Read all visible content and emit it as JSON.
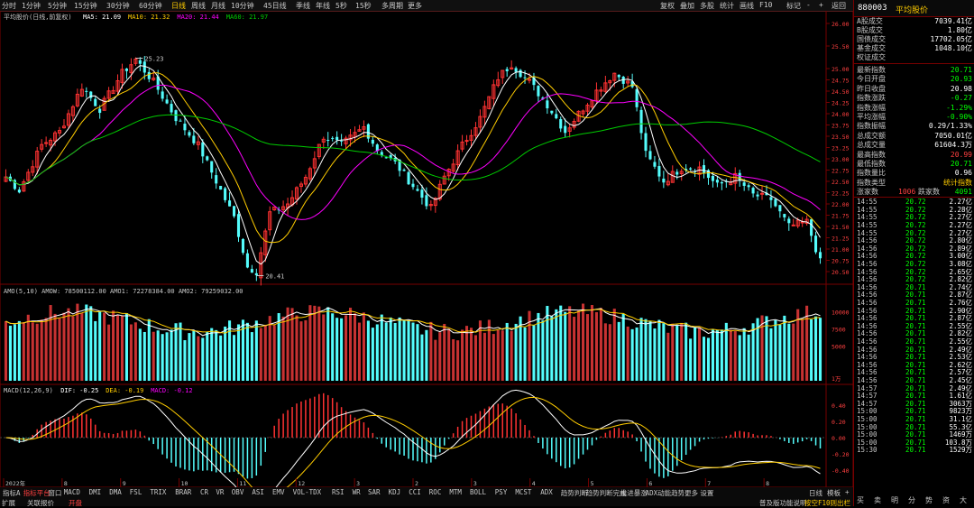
{
  "toolbar": {
    "periods": [
      "分时",
      "1分钟",
      "5分钟",
      "15分钟",
      "30分钟",
      "60分钟",
      "日线",
      "周线",
      "月线",
      "10分钟",
      "45日线",
      "季线",
      "年线",
      "5秒",
      "15秒",
      "多周期",
      "更多"
    ],
    "active_period": "日线",
    "right_buttons": [
      "复权",
      "叠加",
      "多股",
      "统计",
      "画线",
      "F10",
      "标记",
      "-",
      "+",
      "返回"
    ]
  },
  "main_chart": {
    "title": "平均股价(日线,前复权)",
    "ma": [
      {
        "label": "MA5: 21.09",
        "color": "#ffffff"
      },
      {
        "label": "MA10: 21.32",
        "color": "#ffcc00"
      },
      {
        "label": "MA20: 21.44",
        "color": "#ff00ff"
      },
      {
        "label": "MA60: 21.97",
        "color": "#00cc00"
      }
    ],
    "high_label": "25.23",
    "low_label": "20.41",
    "price_ticks": [
      "26.00",
      "25.50",
      "25.00",
      "24.75",
      "24.50",
      "24.25",
      "24.00",
      "23.75",
      "23.50",
      "23.25",
      "23.00",
      "22.75",
      "22.50",
      "22.25",
      "22.00",
      "21.75",
      "21.50",
      "21.25",
      "21.00",
      "20.75",
      "20.50"
    ]
  },
  "volume_panel": {
    "title": "AMO(5,10)  AMOW: 78500112.00  AMO1: 72278384.00  AMO2: 79259032.00",
    "ticks": [
      "10000",
      "7500",
      "5000"
    ],
    "unit_label": "1万"
  },
  "macd_panel": {
    "title_parts": [
      {
        "label": "MACD(12,26,9)",
        "color": "#c8c8c8"
      },
      {
        "label": "DIF: -0.25",
        "color": "#ffffff"
      },
      {
        "label": "DEA: -0.19",
        "color": "#ffcc00"
      },
      {
        "label": "MACD: -0.12",
        "color": "#ff00ff"
      }
    ],
    "ticks": [
      "0.40",
      "0.20",
      "0.00",
      "-0.20",
      "-0.40"
    ],
    "date_ticks": [
      "2022年",
      "8",
      "9",
      "10",
      "11",
      "12",
      "3",
      "2",
      "3",
      "4",
      "5",
      "6",
      "7",
      "8"
    ]
  },
  "right_panel": {
    "code": "880003",
    "name": "平均股价",
    "stats": [
      {
        "label": "A股成交",
        "value": "7039.41亿",
        "color": "#ffffff"
      },
      {
        "label": "B股成交",
        "value": "1.80亿",
        "color": "#ffffff"
      },
      {
        "label": "国债成交",
        "value": "17702.05亿",
        "color": "#ffffff"
      },
      {
        "label": "基金成交",
        "value": "1048.10亿",
        "color": "#ffffff"
      },
      {
        "label": "权证成交",
        "value": "",
        "color": "#ffffff"
      }
    ],
    "index_stats": [
      {
        "label": "最新指数",
        "value": "20.71",
        "color": "#00ff00"
      },
      {
        "label": "今日开盘",
        "value": "20.93",
        "color": "#00ff00"
      },
      {
        "label": "昨日收盘",
        "value": "20.98",
        "color": "#ffffff"
      },
      {
        "label": "指数涨跌",
        "value": "-0.27",
        "color": "#00ff00"
      },
      {
        "label": "指数涨幅",
        "value": "-1.29%",
        "color": "#00ff00"
      },
      {
        "label": "平均涨幅",
        "value": "-0.90%",
        "color": "#00ff00"
      },
      {
        "label": "指数振幅",
        "value": "0.29/1.33%",
        "color": "#ffffff"
      },
      {
        "label": "总成交额",
        "value": "7050.01亿",
        "color": "#ffffff"
      },
      {
        "label": "总成交量",
        "value": "61604.3万",
        "color": "#ffffff"
      },
      {
        "label": "最高指数",
        "value": "20.99",
        "color": "#ff4040"
      },
      {
        "label": "最低指数",
        "value": "20.71",
        "color": "#00ff00"
      },
      {
        "label": "指数量比",
        "value": "0.96",
        "color": "#ffffff"
      },
      {
        "label": "指数类型",
        "value": "统计指数",
        "color": "#ffcc00"
      }
    ],
    "updown": {
      "up_label": "涨家数",
      "up_value": "1006",
      "down_label": "跌家数",
      "down_value": "4091"
    },
    "ticks": [
      {
        "t": "14:55",
        "p": "20.72",
        "v": "2.27亿"
      },
      {
        "t": "14:55",
        "p": "20.72",
        "v": "2.28亿"
      },
      {
        "t": "14:55",
        "p": "20.72",
        "v": "2.27亿"
      },
      {
        "t": "14:55",
        "p": "20.72",
        "v": "2.27亿"
      },
      {
        "t": "14:55",
        "p": "20.72",
        "v": "2.27亿"
      },
      {
        "t": "14:56",
        "p": "20.72",
        "v": "2.80亿"
      },
      {
        "t": "14:56",
        "p": "20.72",
        "v": "2.89亿"
      },
      {
        "t": "14:56",
        "p": "20.72",
        "v": "3.00亿"
      },
      {
        "t": "14:56",
        "p": "20.72",
        "v": "3.08亿"
      },
      {
        "t": "14:56",
        "p": "20.72",
        "v": "2.65亿"
      },
      {
        "t": "14:56",
        "p": "20.72",
        "v": "2.82亿"
      },
      {
        "t": "14:56",
        "p": "20.71",
        "v": "2.74亿"
      },
      {
        "t": "14:56",
        "p": "20.71",
        "v": "2.87亿"
      },
      {
        "t": "14:56",
        "p": "20.71",
        "v": "2.76亿"
      },
      {
        "t": "14:56",
        "p": "20.71",
        "v": "2.90亿"
      },
      {
        "t": "14:56",
        "p": "20.71",
        "v": "2.87亿"
      },
      {
        "t": "14:56",
        "p": "20.71",
        "v": "2.55亿"
      },
      {
        "t": "14:56",
        "p": "20.71",
        "v": "2.82亿"
      },
      {
        "t": "14:56",
        "p": "20.71",
        "v": "2.55亿"
      },
      {
        "t": "14:56",
        "p": "20.71",
        "v": "2.49亿"
      },
      {
        "t": "14:56",
        "p": "20.71",
        "v": "2.53亿"
      },
      {
        "t": "14:56",
        "p": "20.71",
        "v": "2.62亿"
      },
      {
        "t": "14:56",
        "p": "20.71",
        "v": "2.57亿"
      },
      {
        "t": "14:56",
        "p": "20.71",
        "v": "2.45亿"
      },
      {
        "t": "14:57",
        "p": "20.71",
        "v": "2.49亿"
      },
      {
        "t": "14:57",
        "p": "20.71",
        "v": "1.61亿"
      },
      {
        "t": "14:57",
        "p": "20.71",
        "v": "3063万"
      },
      {
        "t": "15:00",
        "p": "20.71",
        "v": "9823万"
      },
      {
        "t": "15:00",
        "p": "20.71",
        "v": "31.1亿"
      },
      {
        "t": "15:00",
        "p": "20.71",
        "v": "55.3亿"
      },
      {
        "t": "15:00",
        "p": "20.71",
        "v": "1469万"
      },
      {
        "t": "15:00",
        "p": "20.71",
        "v": "103.8万"
      },
      {
        "t": "15:30",
        "p": "20.71",
        "v": "1529万"
      }
    ],
    "bottom_buttons": [
      "买",
      "卖",
      "明",
      "分",
      "势",
      "资",
      "大"
    ]
  },
  "bottom_bar": {
    "indicators": [
      "指标A",
      "指标平台",
      "窗口",
      "MACD",
      "DMI",
      "DMA",
      "FSL",
      "TRIX",
      "BRAR",
      "CR",
      "VR",
      "OBV",
      "ASI",
      "EMV",
      "VOL-TDX",
      "RSI",
      "WR",
      "SAR",
      "KDJ",
      "CCI",
      "ROC",
      "MTM",
      "BOLL",
      "PSY",
      "MCST",
      "ADX",
      "趋势判断",
      "趋势判断完成",
      "推进暴涨",
      "ADX动能趋势",
      "更多",
      "设置"
    ],
    "active": "指标平台",
    "row2": [
      "扩展",
      "关联报价",
      "开盘"
    ],
    "status_text": "普及版功能说明",
    "status_right": "按空F10则出栏",
    "right_tags": [
      "日线",
      "模板",
      "+"
    ]
  },
  "chart_data": {
    "type": "candlestick",
    "title": "平均股价(日线,前复权)",
    "ylim": [
      20.41,
      26.0
    ],
    "annotations": [
      {
        "label": "25.23",
        "value": 25.23
      },
      {
        "label": "20.41",
        "value": 20.41
      }
    ],
    "anchors": [
      [
        0,
        22.6
      ],
      [
        3,
        22.3
      ],
      [
        8,
        23.3
      ],
      [
        12,
        23.6
      ],
      [
        17,
        24.6
      ],
      [
        21,
        24.1
      ],
      [
        26,
        24.9
      ],
      [
        29,
        25.2
      ],
      [
        33,
        24.7
      ],
      [
        38,
        23.9
      ],
      [
        43,
        23.3
      ],
      [
        47,
        22.5
      ],
      [
        51,
        21.7
      ],
      [
        54,
        20.6
      ],
      [
        56,
        20.5
      ],
      [
        59,
        21.8
      ],
      [
        63,
        22.0
      ],
      [
        67,
        22.6
      ],
      [
        71,
        23.5
      ],
      [
        75,
        23.3
      ],
      [
        80,
        23.7
      ],
      [
        83,
        23.2
      ],
      [
        87,
        22.9
      ],
      [
        91,
        22.4
      ],
      [
        95,
        21.9
      ],
      [
        98,
        22.6
      ],
      [
        102,
        23.3
      ],
      [
        106,
        23.9
      ],
      [
        110,
        24.8
      ],
      [
        113,
        25.1
      ],
      [
        117,
        24.7
      ],
      [
        121,
        24.2
      ],
      [
        125,
        23.6
      ],
      [
        128,
        24.0
      ],
      [
        132,
        24.5
      ],
      [
        136,
        24.9
      ],
      [
        140,
        24.6
      ],
      [
        143,
        23.1
      ],
      [
        147,
        22.5
      ],
      [
        151,
        22.8
      ],
      [
        155,
        22.8
      ],
      [
        159,
        22.4
      ],
      [
        163,
        22.6
      ],
      [
        167,
        22.2
      ],
      [
        171,
        22.1
      ],
      [
        175,
        21.5
      ],
      [
        179,
        21.6
      ],
      [
        182,
        20.71
      ]
    ],
    "volume_ylim": [
      0,
      12000
    ],
    "macd_ylim": [
      -0.5,
      0.5
    ]
  }
}
